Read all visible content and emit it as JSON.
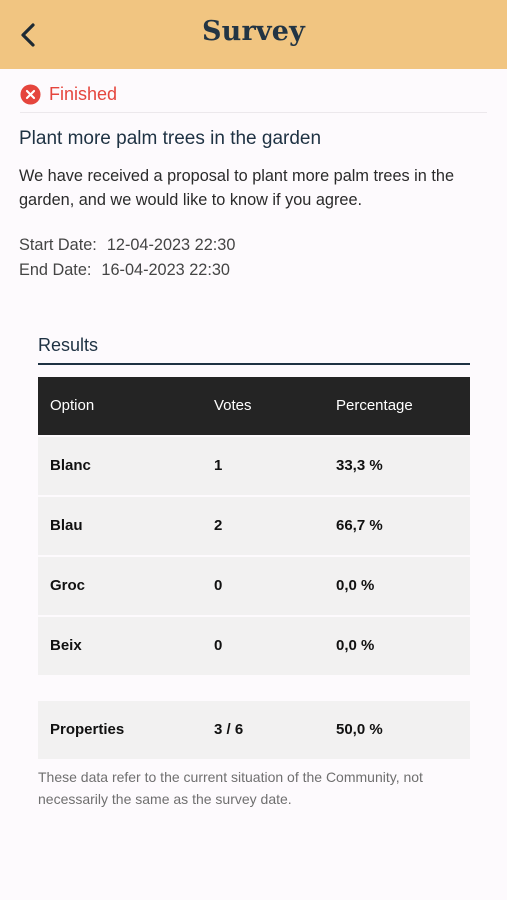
{
  "header": {
    "title": "Survey",
    "back_icon": "chevron-left-icon",
    "background_color": "#f1c581"
  },
  "status": {
    "label": "Finished",
    "icon": "close-circle-icon",
    "color": "#e5453d"
  },
  "survey": {
    "title": "Plant more palm trees in the garden",
    "description": "We have received a proposal to plant more palm trees in the garden, and we would like to know if you agree.",
    "start_label": "Start Date:",
    "start_value": "12-04-2023 22:30",
    "end_label": "End Date:",
    "end_value": "16-04-2023 22:30"
  },
  "results": {
    "title": "Results",
    "columns": [
      "Option",
      "Votes",
      "Percentage"
    ],
    "rows": [
      {
        "option": "Blanc",
        "votes": "1",
        "percentage": "33,3 %"
      },
      {
        "option": "Blau",
        "votes": "2",
        "percentage": "66,7 %"
      },
      {
        "option": "Groc",
        "votes": "0",
        "percentage": "0,0 %"
      },
      {
        "option": "Beix",
        "votes": "0",
        "percentage": "0,0 %"
      }
    ],
    "totals": {
      "label": "Properties",
      "votes": "3 / 6",
      "percentage": "50,0 %"
    },
    "note": "These data refer to the current situation of the Community, not necessarily the same as the survey date."
  }
}
